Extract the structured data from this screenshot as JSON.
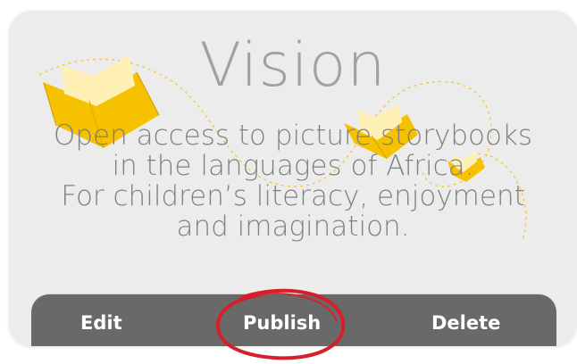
{
  "vision": {
    "title": "Vision",
    "lines": [
      "Open access to picture storybooks",
      "in the languages of Africa.",
      "For children’s literacy, enjoyment",
      "and imagination."
    ]
  },
  "toolbar": {
    "edit_label": "Edit",
    "publish_label": "Publish",
    "delete_label": "Delete"
  },
  "colors": {
    "card_background": "#ececec",
    "toolbar_background": "#696969",
    "book_yellow": "#f6c200",
    "highlight_red": "#d61f2b",
    "text_gray": "#8a8a8a"
  },
  "icons": {
    "large_book": "open-book-icon",
    "medium_book": "open-book-icon",
    "small_book": "open-book-icon",
    "highlight": "hand-drawn-circle-icon"
  }
}
